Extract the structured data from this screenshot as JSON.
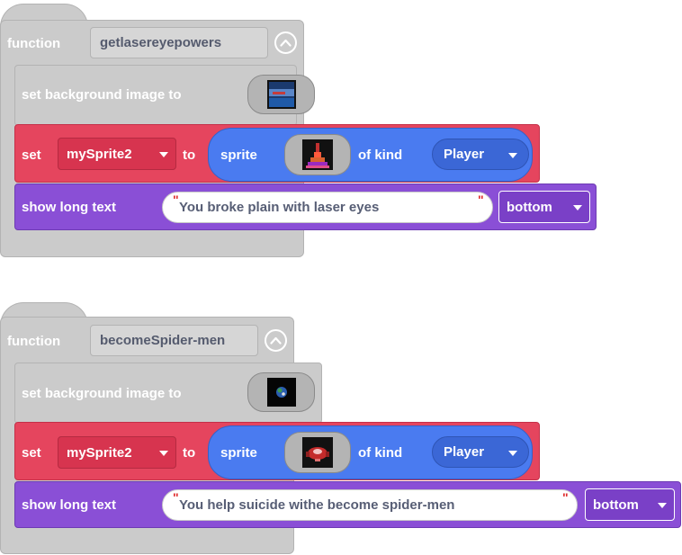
{
  "functions": [
    {
      "keyword": "function",
      "name": "getlasereyepowers",
      "background_label": "set background image to",
      "set_label": "set",
      "variable": "mySprite2",
      "to_label": "to",
      "sprite_label": "sprite",
      "of_kind_label": "of kind",
      "kind": "Player",
      "show_text_label": "show long text",
      "text_value": "You broke plain with laser eyes",
      "position": "bottom"
    },
    {
      "keyword": "function",
      "name": "becomeSpider-men",
      "background_label": "set background image to",
      "set_label": "set",
      "variable": "mySprite2",
      "to_label": "to",
      "sprite_label": "sprite",
      "of_kind_label": "of kind",
      "kind": "Player",
      "show_text_label": "show long text",
      "text_value": "You help suicide withe become spider-men",
      "position": "bottom"
    }
  ],
  "colors": {
    "function_block": "#cbcbcb",
    "set_block": "#e5455e",
    "sprite_block": "#4a7bf0",
    "text_block": "#8a4fd6"
  },
  "icons": [
    "collapse-chevron-icon",
    "background-image-thumbnail",
    "sprite-image-thumbnail",
    "dropdown-arrow-icon"
  ]
}
